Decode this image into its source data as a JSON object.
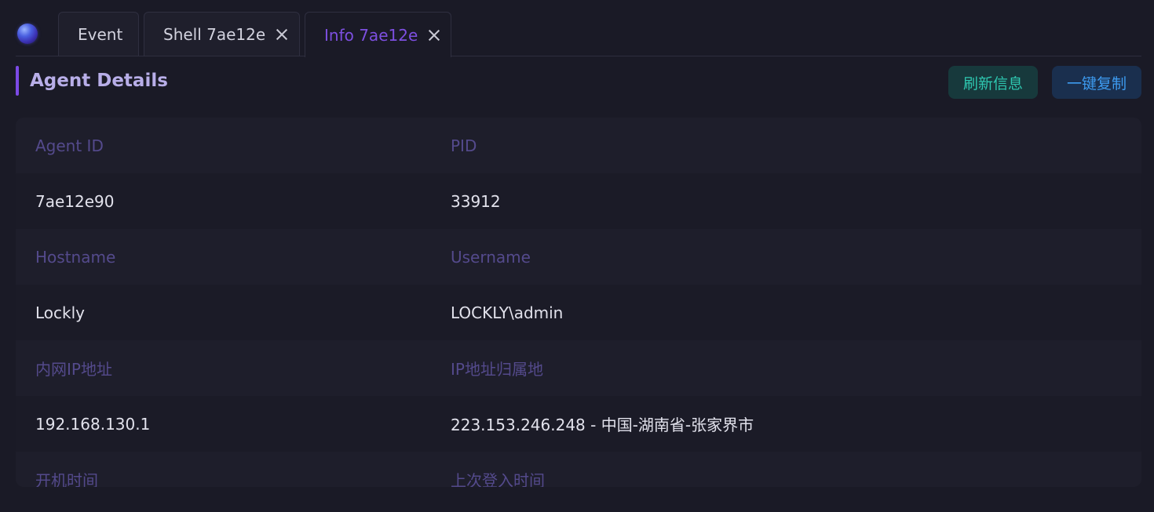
{
  "tabs": [
    {
      "label": "Event",
      "closable": false,
      "active": false
    },
    {
      "label": "Shell 7ae12e",
      "closable": true,
      "active": false
    },
    {
      "label": "Info 7ae12e",
      "closable": true,
      "active": true
    }
  ],
  "header": {
    "title": "Agent Details",
    "refresh_label": "刷新信息",
    "copy_label": "一键复制"
  },
  "details": {
    "rows": [
      {
        "left_label": "Agent ID",
        "left_value": "7ae12e90",
        "right_label": "PID",
        "right_value": "33912"
      },
      {
        "left_label": "Hostname",
        "left_value": "Lockly",
        "right_label": "Username",
        "right_value": "LOCKLY\\admin"
      },
      {
        "left_label": "内网IP地址",
        "left_value": "192.168.130.1",
        "right_label": "IP地址归属地",
        "right_value": "223.153.246.248 - 中国-湖南省-张家界市"
      },
      {
        "left_label": "开机时间",
        "right_label": "上次登入时间"
      }
    ]
  },
  "colors": {
    "accent": "#7c4ae6",
    "active_tab_text": "#7d4fe0",
    "refresh_button": "#2ec7b0",
    "copy_button": "#3d9bf0",
    "label_text": "#544a8c"
  },
  "icons": {
    "logo": "sphere-logo-icon",
    "tab_close": "close-icon"
  }
}
